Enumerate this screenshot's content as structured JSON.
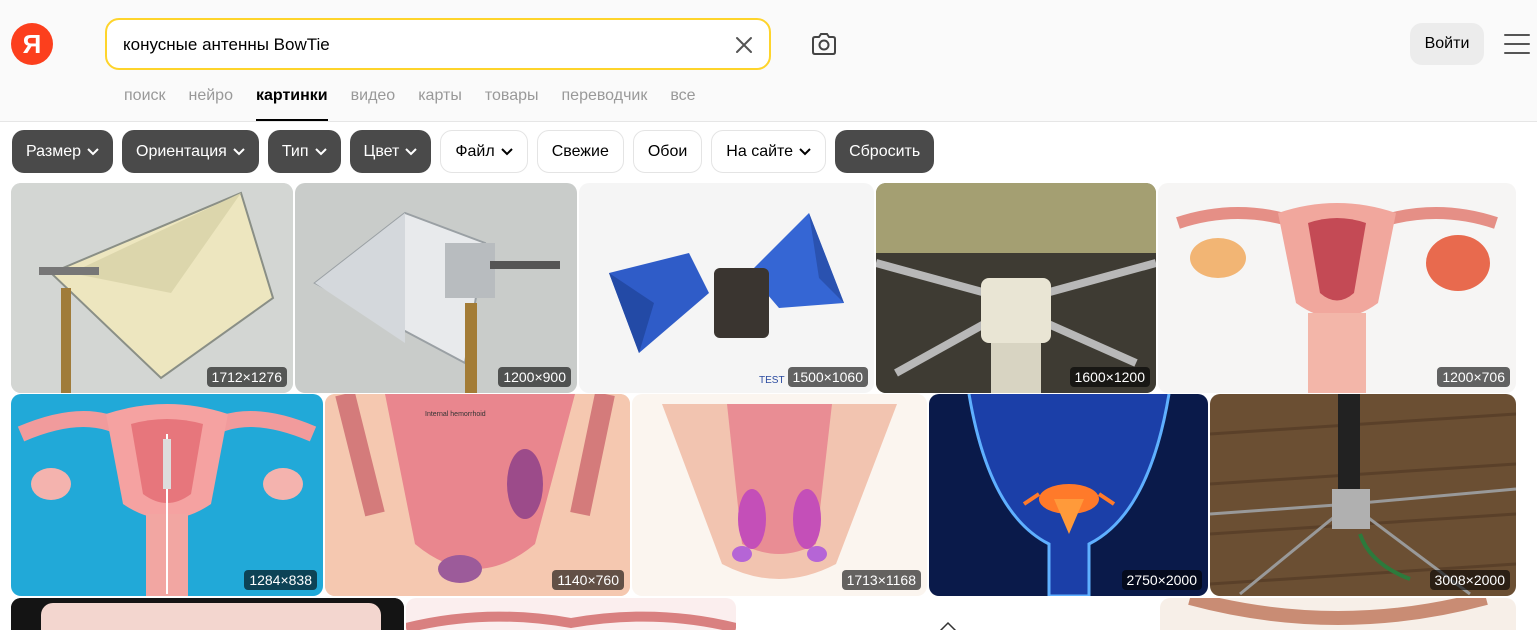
{
  "header": {
    "logo_letter": "Я",
    "search": {
      "value": "конусные антенны BowTie"
    },
    "login_label": "Войти"
  },
  "tabs": [
    {
      "label": "поиск",
      "active": false
    },
    {
      "label": "нейро",
      "active": false
    },
    {
      "label": "картинки",
      "active": true
    },
    {
      "label": "видео",
      "active": false
    },
    {
      "label": "карты",
      "active": false
    },
    {
      "label": "товары",
      "active": false
    },
    {
      "label": "переводчик",
      "active": false
    },
    {
      "label": "все",
      "active": false
    }
  ],
  "filters": [
    {
      "label": "Размер",
      "style": "dark",
      "dropdown": true
    },
    {
      "label": "Ориентация",
      "style": "dark",
      "dropdown": true
    },
    {
      "label": "Тип",
      "style": "dark",
      "dropdown": true
    },
    {
      "label": "Цвет",
      "style": "dark",
      "dropdown": true
    },
    {
      "label": "Файл",
      "style": "light",
      "dropdown": true
    },
    {
      "label": "Свежие",
      "style": "light",
      "dropdown": false
    },
    {
      "label": "Обои",
      "style": "light",
      "dropdown": false
    },
    {
      "label": "На сайте",
      "style": "light",
      "dropdown": true
    },
    {
      "label": "Сбросить",
      "style": "dark",
      "dropdown": false
    }
  ],
  "results": {
    "row1": [
      {
        "size": "1712×1276"
      },
      {
        "size": "1200×900"
      },
      {
        "size": "1500×1060"
      },
      {
        "size": "1600×1200"
      },
      {
        "size": "1200×706"
      }
    ],
    "row2": [
      {
        "size": "1284×838"
      },
      {
        "size": "1140×760"
      },
      {
        "size": "1713×1168"
      },
      {
        "size": "2750×2000"
      },
      {
        "size": "3008×2000"
      }
    ]
  },
  "colors": {
    "accent": "#fed42b",
    "brand": "#fc3f1d"
  }
}
